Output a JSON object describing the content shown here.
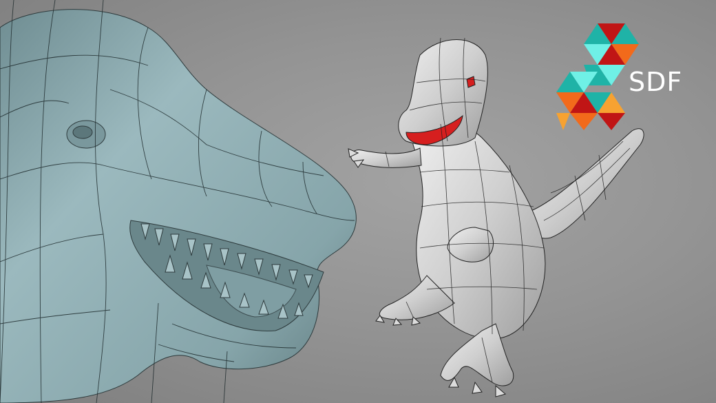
{
  "logo": {
    "text": "SDF",
    "icon": "sdf-stacked-triangles-logo",
    "colors": {
      "teal": "#1fb3a7",
      "cyan": "#6ff0e6",
      "red": "#c01515",
      "orange": "#f26a1b",
      "light_orange": "#f7a231"
    }
  },
  "colors": {
    "background": "#949494",
    "large_model": "#88a7ac",
    "small_model": "#d4d4d4",
    "mouth_highlight": "#d61f1f",
    "wireframe": "#1e2a2c"
  }
}
